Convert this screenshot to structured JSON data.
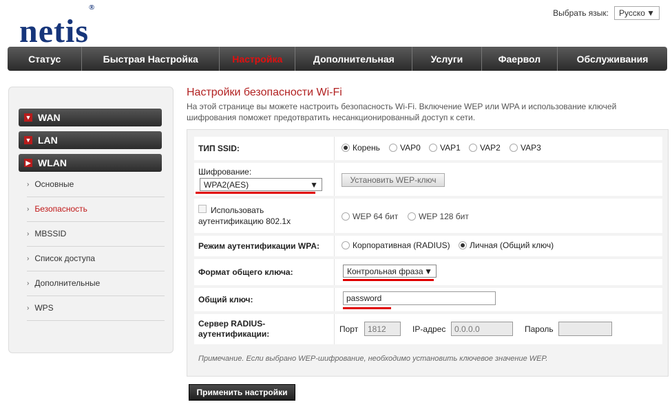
{
  "brand": {
    "logo": "netis",
    "reg": "®"
  },
  "language": {
    "label": "Выбрать язык:",
    "value": "Русско"
  },
  "nav": [
    {
      "label": "Статус"
    },
    {
      "label": "Быстрая Настройка"
    },
    {
      "label": "Настройка"
    },
    {
      "label": "Дополнительная"
    },
    {
      "label": "Услуги"
    },
    {
      "label": "Фаервол"
    },
    {
      "label": "Обслуживания"
    }
  ],
  "sidebar": {
    "groups": [
      {
        "label": "WAN"
      },
      {
        "label": "LAN"
      },
      {
        "label": "WLAN"
      }
    ],
    "items": [
      {
        "label": "Основные"
      },
      {
        "label": "Безопасность"
      },
      {
        "label": "MBSSID"
      },
      {
        "label": "Список доступа"
      },
      {
        "label": "Дополнительные"
      },
      {
        "label": "WPS"
      }
    ]
  },
  "page": {
    "title": "Настройки безопасности Wi-Fi",
    "description": "На этой странице вы можете настроить безопасность Wi-Fi. Включение WEP или WPA и использование ключей шифрования поможет предотвратить несанкционированный доступ к сети."
  },
  "form": {
    "ssid_type": {
      "label": "ТИП SSID:",
      "options": [
        "Корень",
        "VAP0",
        "VAP1",
        "VAP2",
        "VAP3"
      ]
    },
    "encryption": {
      "label": "Шифрование:",
      "value": "WPA2(AES)",
      "wep_button": "Установить WEP-ключ"
    },
    "auth8021x": {
      "label": "Использовать аутентификацию 802.1x",
      "opt1": "WEP 64 бит",
      "opt2": "WEP 128 бит"
    },
    "wpa_mode": {
      "label": "Режим аутентификации WPA:",
      "opt1": "Корпоративная (RADIUS)",
      "opt2": "Личная (Общий ключ)"
    },
    "key_format": {
      "label": "Формат общего ключа:",
      "value": "Контрольная фраза"
    },
    "shared_key": {
      "label": "Общий ключ:",
      "value": "password"
    },
    "radius": {
      "label": "Сервер RADIUS-аутентификации:",
      "port_label": "Порт",
      "port_value": "1812",
      "ip_label": "IP-адрес",
      "ip_value": "0.0.0.0",
      "pass_label": "Пароль"
    },
    "note": "Примечание. Если выбрано WEP-шифрование, необходимо установить ключевое значение WEP."
  },
  "apply_button": "Применить настройки"
}
